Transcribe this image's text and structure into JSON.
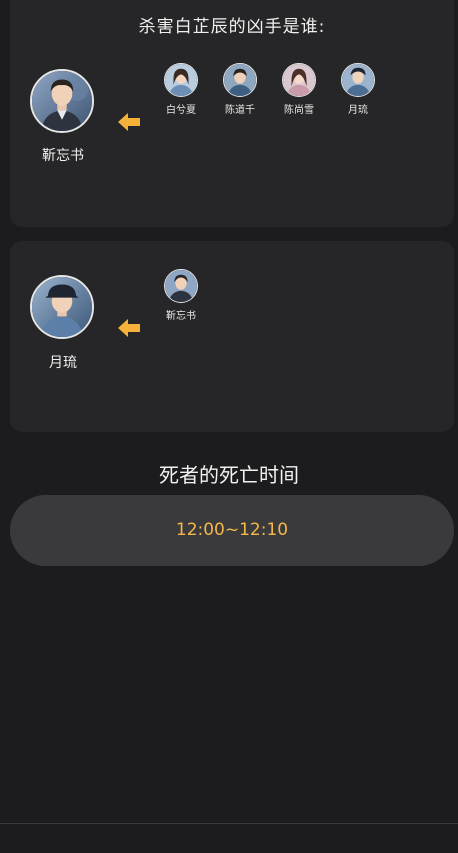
{
  "question": {
    "title": "杀害白芷辰的凶手是谁:"
  },
  "card1": {
    "main": {
      "name": "靳忘书",
      "icon": "male-suspect-avatar"
    },
    "arrow_icon": "arrow-left-icon",
    "choices": [
      {
        "name": "白兮夏",
        "icon": "female-suspect-avatar"
      },
      {
        "name": "陈道千",
        "icon": "male-suspect-avatar"
      },
      {
        "name": "陈尚雪",
        "icon": "female-suspect-avatar"
      },
      {
        "name": "月琉",
        "icon": "male-suspect-avatar"
      }
    ]
  },
  "card2": {
    "main": {
      "name": "月琉",
      "icon": "male-suspect-avatar"
    },
    "arrow_icon": "arrow-left-icon",
    "choices": [
      {
        "name": "靳忘书",
        "icon": "male-suspect-avatar"
      }
    ]
  },
  "death_time": {
    "title": "死者的死亡时间",
    "value": "12:00~12:10"
  },
  "colors": {
    "background": "#1c1c1e",
    "card": "#262628",
    "pill": "#3a3a3c",
    "accent": "#f5b74a",
    "arrow": "#f5b23a"
  }
}
